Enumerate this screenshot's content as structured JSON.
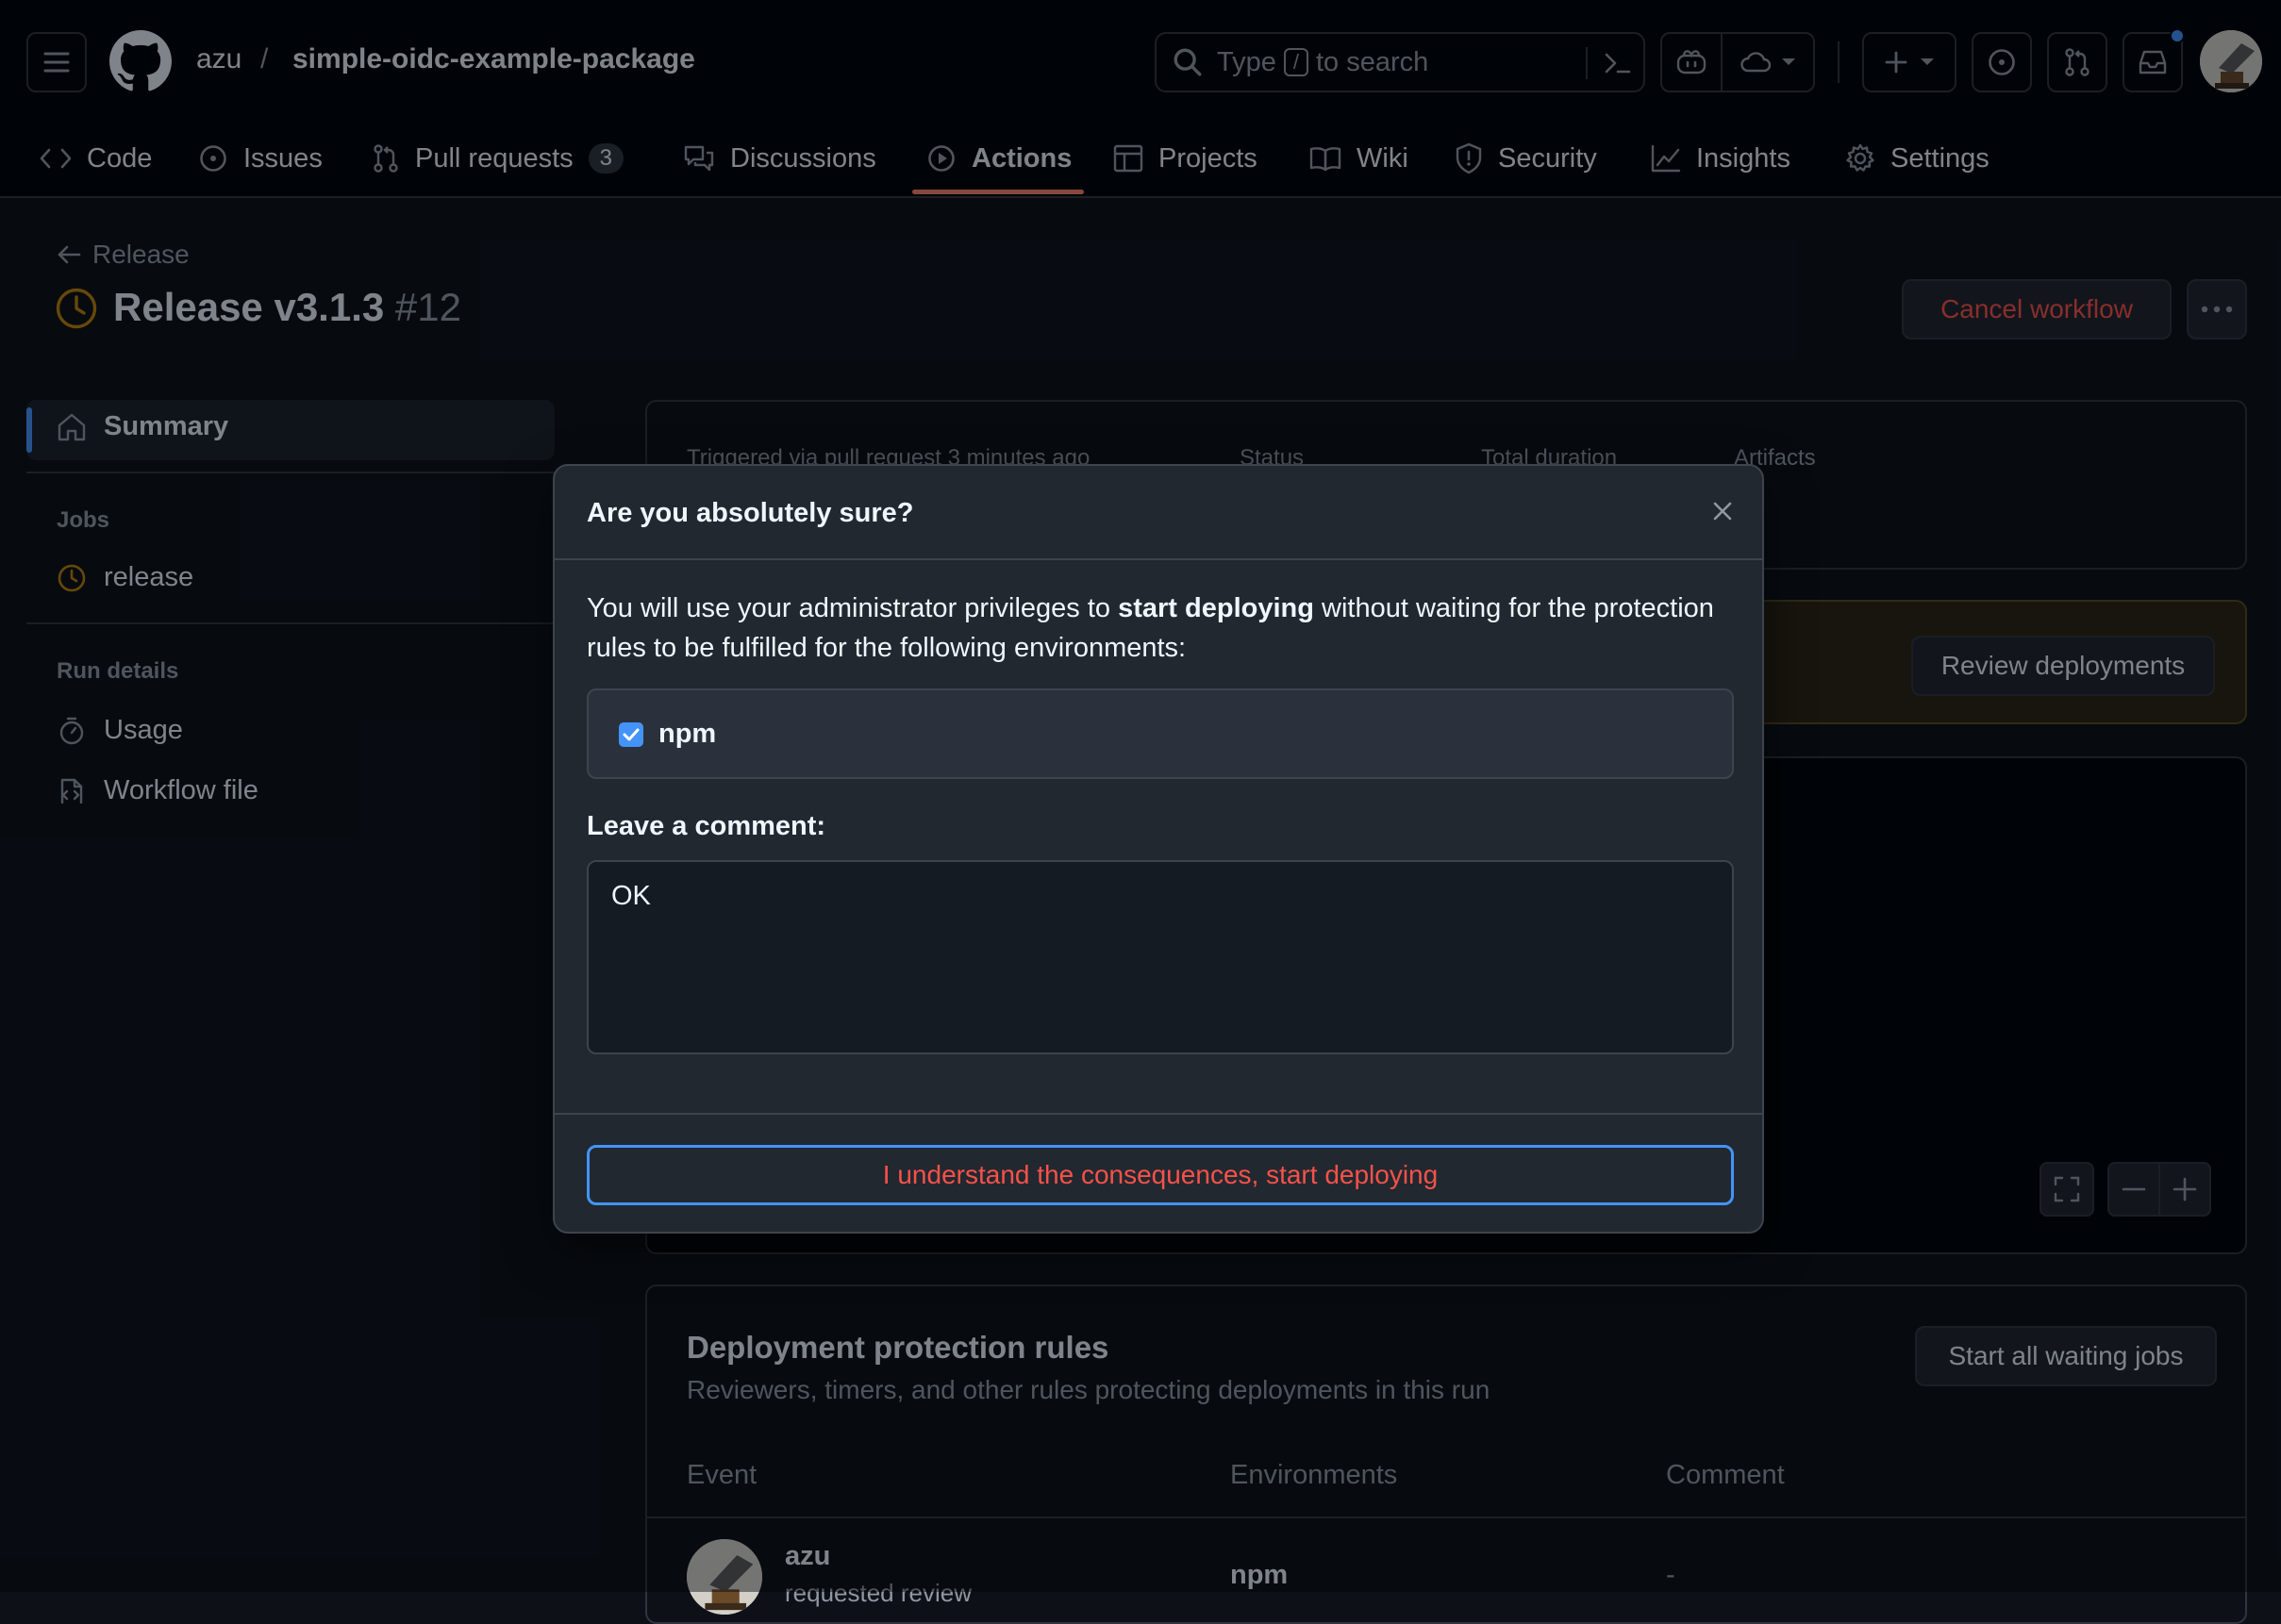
{
  "header": {
    "owner": "azu",
    "slash": "/",
    "repo": "simple-oidc-example-package",
    "search": {
      "prefix": "Type",
      "key": "/",
      "suffix": "to search"
    }
  },
  "tabs": [
    {
      "label": "Code",
      "icon": "code-icon"
    },
    {
      "label": "Issues",
      "icon": "issue-opened-icon"
    },
    {
      "label": "Pull requests",
      "icon": "git-pull-request-icon",
      "count": "3"
    },
    {
      "label": "Discussions",
      "icon": "comment-discussion-icon"
    },
    {
      "label": "Actions",
      "icon": "play-icon",
      "active": true
    },
    {
      "label": "Projects",
      "icon": "table-icon"
    },
    {
      "label": "Wiki",
      "icon": "book-icon"
    },
    {
      "label": "Security",
      "icon": "shield-icon"
    },
    {
      "label": "Insights",
      "icon": "graph-icon"
    },
    {
      "label": "Settings",
      "icon": "gear-icon"
    }
  ],
  "run": {
    "back_label": "Release",
    "title": "Release v3.1.3",
    "number": "#12",
    "cancel_label": "Cancel workflow",
    "more_label": "···"
  },
  "sidebar": {
    "summary": "Summary",
    "jobs_heading": "Jobs",
    "job": "release",
    "run_details_heading": "Run details",
    "usage": "Usage",
    "workflow_file": "Workflow file"
  },
  "summary": {
    "triggered": "Triggered via pull request 3 minutes ago",
    "status_label": "Status",
    "duration_label": "Total duration",
    "artifacts_label": "Artifacts"
  },
  "review_deployments_label": "Review deployments",
  "rules": {
    "title": "Deployment protection rules",
    "subtitle": "Reviewers, timers, and other rules protecting deployments in this run",
    "start_all_label": "Start all waiting jobs",
    "columns": [
      "Event",
      "Environments",
      "Comment"
    ],
    "row": {
      "user": "azu",
      "event": "requested review",
      "environment": "npm",
      "comment": "-"
    }
  },
  "dialog": {
    "title": "Are you absolutely sure?",
    "body_prefix": "You will use your administrator privileges to ",
    "body_bold": "start deploying",
    "body_suffix": " without waiting for the protection rules to be fulfilled for the following environments:",
    "environment": "npm",
    "environment_checked": true,
    "comment_label": "Leave a comment:",
    "comment_value": "OK",
    "confirm_label": "I understand the consequences, start deploying"
  },
  "colors": {
    "accent": "#4493f8",
    "danger": "#f85149",
    "pending": "#bb8009",
    "active_tab_underline": "#f78166"
  }
}
